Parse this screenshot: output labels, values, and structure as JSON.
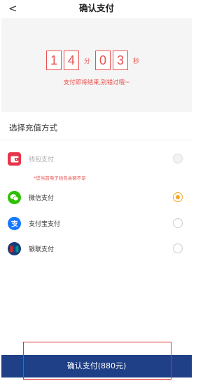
{
  "header": {
    "back": "<",
    "title": "确认支付"
  },
  "countdown": {
    "minutes": [
      "1",
      "4"
    ],
    "minutes_unit": "分",
    "seconds": [
      "0",
      "3"
    ],
    "seconds_unit": "秒",
    "note": "支付即将结束,别错过哦~"
  },
  "section_title": "选择充值方式",
  "methods": [
    {
      "label": "钱包支付",
      "icon": "wallet-icon",
      "color": "#e8344a",
      "state": "disabled"
    },
    {
      "label": "微信支付",
      "icon": "wechat-icon",
      "color": "#2dc100",
      "state": "selected"
    },
    {
      "label": "支付宝支付",
      "icon": "alipay-icon",
      "color": "#1677ff",
      "state": "unselected"
    },
    {
      "label": "银联支付",
      "icon": "unionpay-icon",
      "color": "#1b3a7a",
      "state": "unselected"
    }
  ],
  "wallet_warning": "*您当前电子钱包余额不足",
  "pay_button": "确认支付(880元)",
  "colors": {
    "accent": "#e8524f",
    "primary": "#1f3f86",
    "radio_selected": "#f5a623"
  }
}
